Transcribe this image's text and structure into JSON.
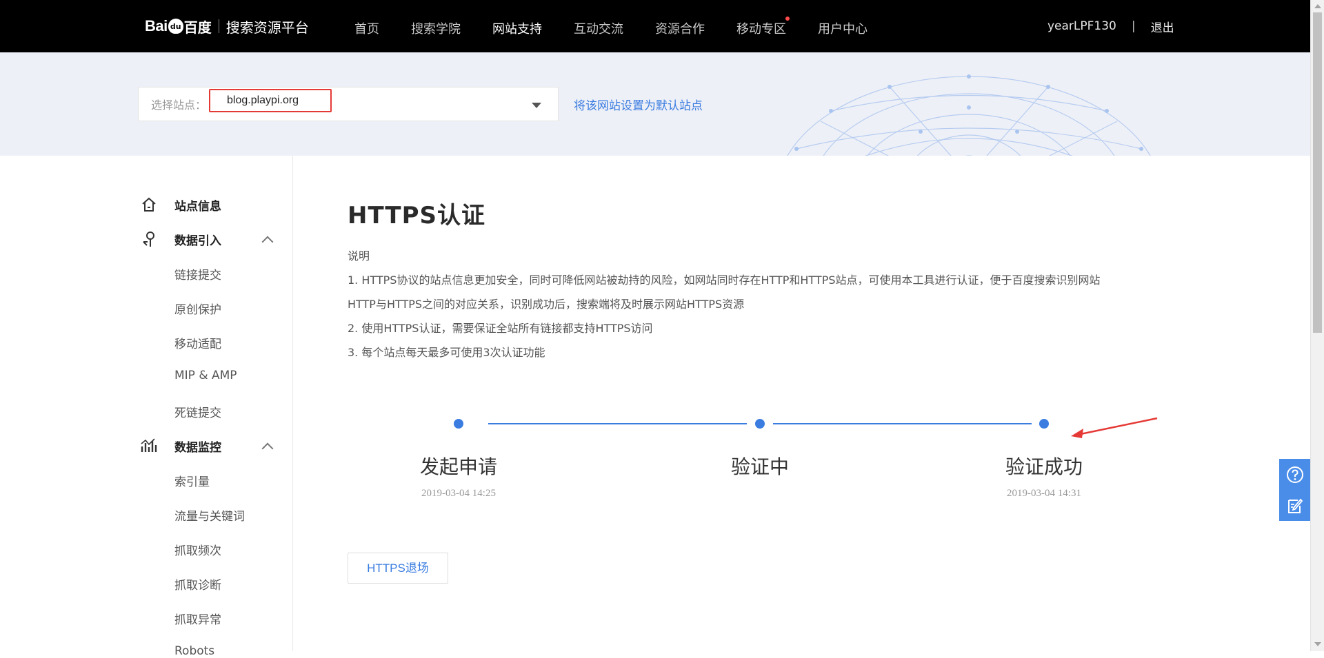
{
  "header": {
    "logo_bai": "Bai",
    "logo_paw": "du",
    "logo_du": "百度",
    "platform_name": "搜索资源平台",
    "nav": [
      {
        "label": "首页",
        "active": false
      },
      {
        "label": "搜索学院",
        "active": false
      },
      {
        "label": "网站支持",
        "active": true
      },
      {
        "label": "互动交流",
        "active": false
      },
      {
        "label": "资源合作",
        "active": false
      },
      {
        "label": "移动专区",
        "active": false,
        "badge": true
      },
      {
        "label": "用户中心",
        "active": false
      }
    ],
    "username": "yearLPF130",
    "separator": "|",
    "logout": "退出"
  },
  "site_selector": {
    "label": "选择站点：",
    "value": "blog.playpi.org",
    "default_link": "将该网站设置为默认站点"
  },
  "sidebar": {
    "sections": [
      {
        "title": "站点信息",
        "icon": "home-icon",
        "items": []
      },
      {
        "title": "数据引入",
        "icon": "data-import-icon",
        "items": [
          "链接提交",
          "原创保护",
          "移动适配",
          "MIP & AMP",
          "死链提交"
        ]
      },
      {
        "title": "数据监控",
        "icon": "data-monitor-icon",
        "items": [
          "索引量",
          "流量与关键词",
          "抓取频次",
          "抓取诊断",
          "抓取异常",
          "Robots"
        ]
      }
    ]
  },
  "main": {
    "title": "HTTPS认证",
    "desc_heading": "说明",
    "desc_lines": [
      "1. HTTPS协议的站点信息更加安全，同时可降低网站被劫持的风险，如网站同时存在HTTP和HTTPS站点，可使用本工具进行认证，便于百度搜索识别网站",
      "HTTP与HTTPS之间的对应关系，识别成功后，搜索端将及时展示网站HTTPS资源",
      "2. 使用HTTPS认证，需要保证全站所有链接都支持HTTPS访问",
      "3. 每个站点每天最多可使用3次认证功能"
    ],
    "steps": [
      {
        "label": "发起申请",
        "time": "2019-03-04 14:25"
      },
      {
        "label": "验证中",
        "time": ""
      },
      {
        "label": "验证成功",
        "time": "2019-03-04 14:31"
      }
    ],
    "exit_button": "HTTPS退场"
  },
  "float_tools": [
    "help-icon",
    "feedback-icon"
  ],
  "colors": {
    "accent": "#3a7ce0",
    "topbar": "#000000",
    "banner": "#eef0f7",
    "highlight": "#e53935"
  }
}
